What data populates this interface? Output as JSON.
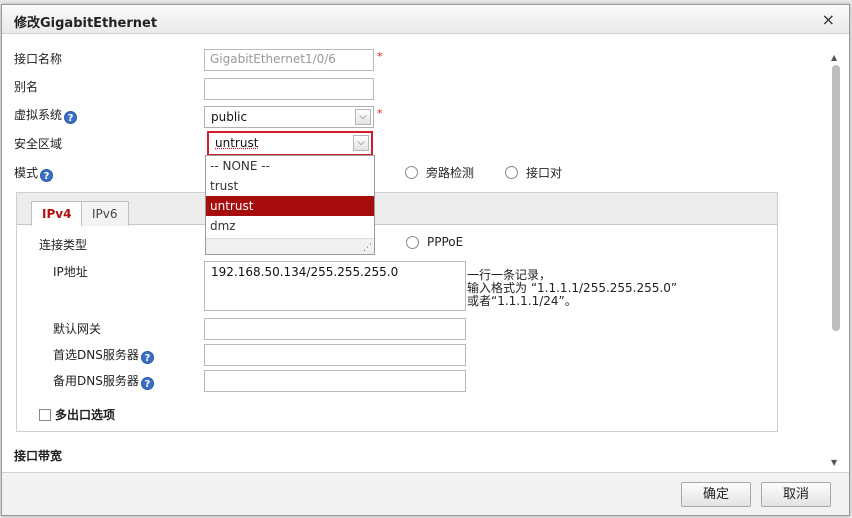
{
  "dialog": {
    "title": "修改GigabitEthernet",
    "close_label": "×"
  },
  "form": {
    "interface_name_label": "接口名称",
    "interface_name_value": "GigabitEthernet1/0/6",
    "alias_label": "别名",
    "alias_value": "",
    "vsys_label": "虚拟系统",
    "vsys_value": "public",
    "zone_label": "安全区域",
    "zone_value": "untrust",
    "mode_label": "模式",
    "mode_options": [
      "旁路检测",
      "接口对"
    ],
    "required_mark": "*",
    "help_glyph": "?"
  },
  "zone_dropdown": {
    "options": [
      "-- NONE --",
      "trust",
      "untrust",
      "dmz"
    ],
    "selected": "untrust",
    "resize_glyph": "⋰"
  },
  "tabs": {
    "ipv4": "IPv4",
    "ipv6": "IPv6"
  },
  "ipv4": {
    "connection_type_label": "连接类型",
    "pppoe_label": "PPPoE",
    "ip_label": "IP地址",
    "ip_value": "192.168.50.134/255.255.255.0",
    "ip_hint_1": "一行一条记录，",
    "ip_hint_2": "输入格式为 “1.1.1.1/255.255.255.0”",
    "ip_hint_3": "或者“1.1.1.1/24”。",
    "gateway_label": "默认网关",
    "primary_dns_label": "首选DNS服务器",
    "backup_dns_label": "备用DNS服务器",
    "multi_exit_label": "多出口选项"
  },
  "bandwidth": {
    "title": "接口带宽"
  },
  "buttons": {
    "ok": "确定",
    "cancel": "取消"
  },
  "icons": {
    "dropdown_arrow": "chevron-down-icon",
    "help": "question-circle-icon",
    "close": "close-icon"
  },
  "colors": {
    "accent_red": "#a80d0d",
    "highlight_border": "#d21d2d",
    "help_blue": "#3a6fc4"
  }
}
